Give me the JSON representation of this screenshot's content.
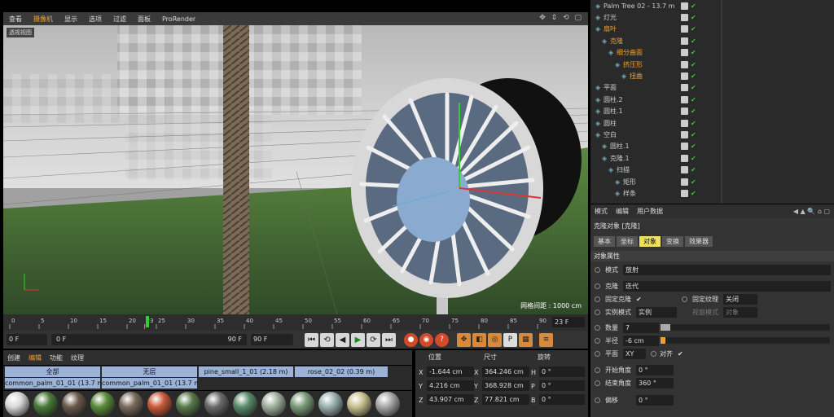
{
  "viewport": {
    "menu": [
      "查看",
      "摄像机",
      "显示",
      "选项",
      "过滤",
      "面板",
      "ProRender"
    ],
    "active_menu": "摄像机",
    "label": "透视视图",
    "grid_distance": "网格间距 : 1000 cm"
  },
  "timeline": {
    "ticks": [
      "0",
      "5",
      "10",
      "15",
      "20",
      "23",
      "25",
      "30",
      "35",
      "40",
      "45",
      "50",
      "55",
      "60",
      "65",
      "70",
      "75",
      "80",
      "85",
      "90"
    ],
    "current_frame": "23 F"
  },
  "transport": {
    "start_field": "0 F",
    "range_start": "0 F",
    "range_end": "90 F",
    "end_field": "90 F",
    "buttons": [
      "⏮",
      "⟲",
      "◀",
      "▶",
      "⟳",
      "⏭"
    ]
  },
  "materials": {
    "menu": [
      "创建",
      "编辑",
      "功能",
      "纹理"
    ],
    "selected_menu": "编辑",
    "filters": [
      "全部",
      "无层"
    ],
    "tags": [
      "pine_small_1_01 (2.18 m)",
      "rose_02_02 (0.39 m)"
    ],
    "tags_row2": [
      "common_palm_01_01 (13.7 m)",
      "common_palm_01_01 (13.7 m)"
    ],
    "ball_colors": [
      "#d8d8d8",
      "#4a7a3a",
      "#6a5a4a",
      "#5a8a3a",
      "#7a6a5a",
      "#c85a3a",
      "#5a7a4a",
      "#6a6a6a",
      "#5a8a6a",
      "#a0b0a0",
      "#7a9a7a",
      "#9ab0b0",
      "#c8c090",
      "#a8a8a8"
    ]
  },
  "coords": {
    "headers": [
      "位置",
      "尺寸",
      "旋转"
    ],
    "rows": [
      {
        "axis": "X",
        "pos": "-1.644 cm",
        "size_axis": "X",
        "size": "364.246 cm",
        "rot_axis": "H",
        "rot": "0 °"
      },
      {
        "axis": "Y",
        "pos": "4.216 cm",
        "size_axis": "Y",
        "size": "368.928 cm",
        "rot_axis": "P",
        "rot": "0 °"
      },
      {
        "axis": "Z",
        "pos": "43.907 cm",
        "size_axis": "Z",
        "size": "77.821 cm",
        "rot_axis": "B",
        "rot": "0 °"
      }
    ]
  },
  "objects": [
    {
      "name": "Palm Tree 02 - 13.7 m",
      "indent": 0,
      "color": "#ccc"
    },
    {
      "name": "灯光",
      "indent": 0,
      "color": "#ccc"
    },
    {
      "name": "扇叶",
      "indent": 0,
      "color": "#f0a030"
    },
    {
      "name": "克隆",
      "indent": 1,
      "color": "#f0a030"
    },
    {
      "name": "细分曲面",
      "indent": 2,
      "color": "#f0a030"
    },
    {
      "name": "挤压形",
      "indent": 3,
      "color": "#f0a030"
    },
    {
      "name": "扭曲",
      "indent": 4,
      "color": "#f0a030"
    },
    {
      "name": "平面",
      "indent": 0,
      "color": "#ccc"
    },
    {
      "name": "圆柱.2",
      "indent": 0,
      "color": "#ccc"
    },
    {
      "name": "圆柱.1",
      "indent": 0,
      "color": "#ccc"
    },
    {
      "name": "圆柱",
      "indent": 0,
      "color": "#ccc"
    },
    {
      "name": "空白",
      "indent": 0,
      "color": "#ccc"
    },
    {
      "name": "圆柱.1",
      "indent": 1,
      "color": "#ccc"
    },
    {
      "name": "克隆.1",
      "indent": 1,
      "color": "#ccc"
    },
    {
      "name": "扫描",
      "indent": 2,
      "color": "#ccc"
    },
    {
      "name": "矩形",
      "indent": 3,
      "color": "#ccc"
    },
    {
      "name": "样条",
      "indent": 3,
      "color": "#ccc"
    }
  ],
  "attributes": {
    "menu": [
      "模式",
      "编辑",
      "用户数据"
    ],
    "title": "克隆对象 [克隆]",
    "tabs": [
      "基本",
      "坐标",
      "对象",
      "变换",
      "效果器"
    ],
    "active_tab": "对象",
    "section": "对象属性",
    "mode_label": "模式",
    "mode_value": "放射",
    "clone_label": "克隆",
    "clone_value": "迭代",
    "fix_clone_label": "固定克隆",
    "fix_texture_label": "固定纹理",
    "fix_texture_value": "关闭",
    "instance_label": "实例模式",
    "instance_value": "实例",
    "viewport_mode_label": "视窗模式",
    "viewport_mode_value": "对象",
    "count_label": "数量",
    "count_value": "7",
    "radius_label": "半径",
    "radius_value": "-6 cm",
    "plane_label": "平面",
    "plane_value": "XY",
    "align_label": "对齐",
    "start_angle_label": "开始角度",
    "start_angle_value": "0 °",
    "end_angle_label": "结束角度",
    "end_angle_value": "360 °",
    "offset_label": "偏移",
    "offset_value": "0 °"
  }
}
